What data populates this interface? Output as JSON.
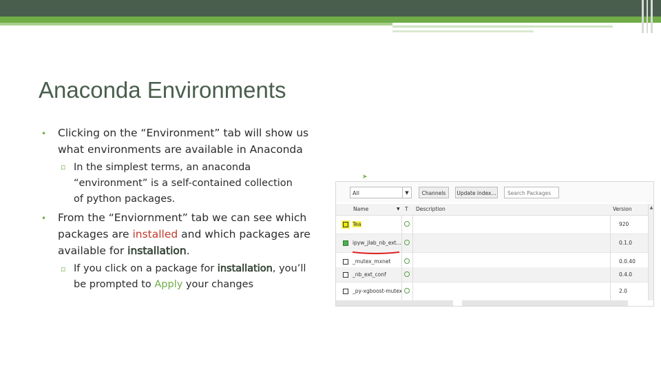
{
  "slide": {
    "title": "Anaconda Environments",
    "bullet1_l1": "Clicking on the “Environment” tab will show us",
    "bullet1_l2": "what environments are available in Anaconda",
    "sub1_l1": "In the simplest terms, an anaconda",
    "sub1_l2": "“environment” is a self-contained collection",
    "sub1_l3": "of python packages.",
    "bullet2_l1": "From the “Enviornment” tab we can see which",
    "bullet2_l2_a": "packages are ",
    "bullet2_l2_installed": "installed",
    "bullet2_l2_b": " and which packages are",
    "bullet2_l3_a": "available for ",
    "bullet2_l3_installation": "installation",
    "bullet2_l3_b": ".",
    "sub2_l1_a": "If you click on a package for ",
    "sub2_l1_installation": "installation",
    "sub2_l1_b": ", you’ll",
    "sub2_l2_a": "be prompted to ",
    "sub2_l2_apply": "Apply",
    "sub2_l2_b": " your changes",
    "bullet_glyph": "•",
    "sub_bullet_glyph": "▫"
  },
  "screenshot": {
    "filter_value": "All",
    "channels_label": "Channels",
    "update_label": "Update index...",
    "search_placeholder": "Search Packages",
    "col_name": "Name",
    "col_t": "T",
    "col_description": "Description",
    "col_version": "Version",
    "rows": [
      {
        "name": "Tea",
        "version": "920"
      },
      {
        "name": "ipyw_jlab_nb_ext...",
        "version": "0.1.0"
      },
      {
        "name": "_mutex_mxnet",
        "version": "0.0.40"
      },
      {
        "name": "_nb_ext_conf",
        "version": "0.4.0"
      },
      {
        "name": "_py-xgboost-mutex",
        "version": "2.0"
      }
    ]
  },
  "colors": {
    "accent_green": "#70ad47",
    "dark_header": "#4a5e4d",
    "highlight_red": "#c0392b"
  }
}
